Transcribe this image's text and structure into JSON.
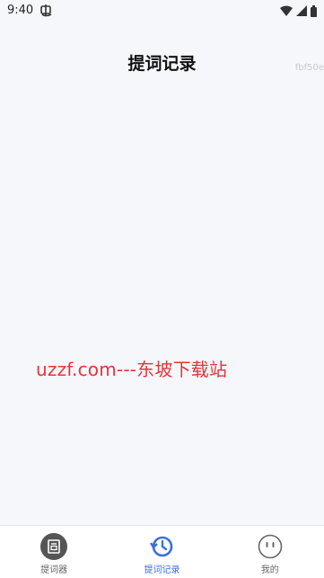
{
  "status_bar": {
    "time": "9:40"
  },
  "header": {
    "title": "提词记录",
    "debug_code": "fbf50e"
  },
  "watermark": "uzzf.com---东坡下载站",
  "tab_bar": {
    "tabs": [
      {
        "label": "提词器",
        "icon": "teleprompter-icon",
        "active": false
      },
      {
        "label": "提词记录",
        "icon": "history-icon",
        "active": true
      },
      {
        "label": "我的",
        "icon": "profile-face-icon",
        "active": false
      }
    ]
  },
  "colors": {
    "background": "#f6f7fb",
    "accent": "#3b6fe0",
    "watermark": "#e8333a"
  }
}
